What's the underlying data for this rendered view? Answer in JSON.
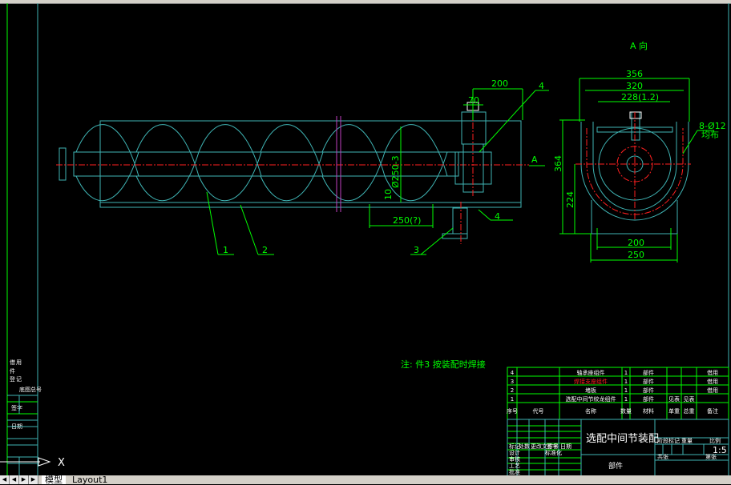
{
  "tabs": {
    "model": "模型",
    "layout1": "Layout1"
  },
  "ucs": {
    "x_label": "X"
  },
  "view_label": "A 向",
  "section_marker": "A",
  "main_view": {
    "dims": {
      "d200": "200",
      "d70": "70",
      "d10": "10",
      "pitch": "250(?)",
      "diameter": "Ø250-3",
      "weld": "4"
    },
    "balloons": [
      "1",
      "2",
      "3",
      "4"
    ]
  },
  "side_view": {
    "dims": {
      "d356": "356",
      "d320": "320",
      "d228": "228(1.2)",
      "d364": "364",
      "d224": "224",
      "d200": "200",
      "d250": "250",
      "holes": "8-Ø12",
      "holes_note": "均布"
    }
  },
  "note": "注: 件3 按装配时焊接",
  "bom": {
    "rows": [
      {
        "no": "4",
        "code": "",
        "name": "轴承座组件",
        "qty": "1",
        "material": "部件",
        "unit_wt": "",
        "total_wt": "",
        "remark": "借用"
      },
      {
        "no": "3",
        "code": "",
        "name": "焊接支座组件",
        "qty": "1",
        "material": "部件",
        "unit_wt": "",
        "total_wt": "",
        "remark": "借用"
      },
      {
        "no": "2",
        "code": "",
        "name": "堵板",
        "qty": "1",
        "material": "部件",
        "unit_wt": "",
        "total_wt": "",
        "remark": "借用"
      },
      {
        "no": "1",
        "code": "",
        "name": "选配中间节绞龙组件",
        "qty": "1",
        "material": "部件",
        "unit_wt": "见表",
        "total_wt": "见表",
        "remark": ""
      }
    ],
    "header": {
      "no": "序号",
      "code": "代号",
      "name": "名称",
      "qty": "数量",
      "material": "材料",
      "unit_wt": "单重",
      "total_wt": "总重",
      "remark": "备注"
    }
  },
  "title_block": {
    "title": "选配中间节装配",
    "subtitle": "部件",
    "scale": "1:5",
    "labels": [
      "标记",
      "处数",
      "更改文件号",
      "签字",
      "日期",
      "设计",
      "标准化",
      "审核",
      "工艺",
      "批准",
      "阶段标记",
      "重量",
      "比例",
      "共张",
      "第张"
    ]
  },
  "left_strip": {
    "labels": [
      "借",
      "用",
      "件",
      "登",
      "记",
      "底图总号",
      "签字",
      "日期"
    ]
  },
  "colors": {
    "background": "#000000",
    "dimension": "#00ff00",
    "outline": "#3fb4b4",
    "center": "#ff2020",
    "weld_mark": "#c040c0"
  }
}
